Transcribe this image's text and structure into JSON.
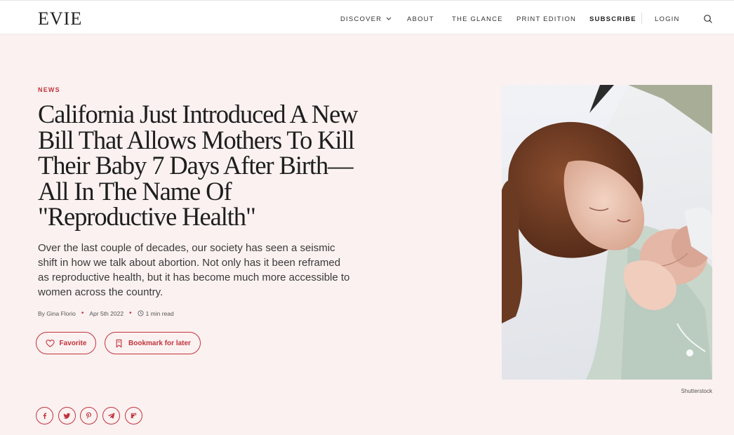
{
  "header": {
    "logo": "EVIE",
    "nav": {
      "discover": "DISCOVER",
      "about": "ABOUT",
      "the_glance": "THE GLANCE",
      "print_edition": "PRINT EDITION",
      "subscribe": "SUBSCRIBE",
      "login": "LOGIN"
    },
    "icons": {
      "discover_dropdown": "chevron-down-icon",
      "search": "search-icon"
    }
  },
  "article": {
    "category": "NEWS",
    "headline": "California Just Introduced A New Bill That Allows Mothers To Kill Their Baby 7 Days After Birth—All In The Name Of \"Reproductive Health\"",
    "dek": "Over the last couple of decades, our society has seen a seismic shift in how we talk about abortion. Not only has it been reframed as reproductive health, but it has become much more accessible to women across the country.",
    "author": "By Gina Florio",
    "date": "Apr 5th 2022",
    "read_time": "1 min read",
    "actions": {
      "favorite": "Favorite",
      "bookmark": "Bookmark for later"
    },
    "image_credit": "Shutterstock"
  },
  "share_icons": [
    "facebook-icon",
    "twitter-icon",
    "pinterest-icon",
    "telegram-icon",
    "flipboard-icon"
  ],
  "colors": {
    "accent": "#c0343c",
    "background": "#fbf1f1",
    "header_bg": "#ffffff",
    "text": "#1e1e1e"
  }
}
